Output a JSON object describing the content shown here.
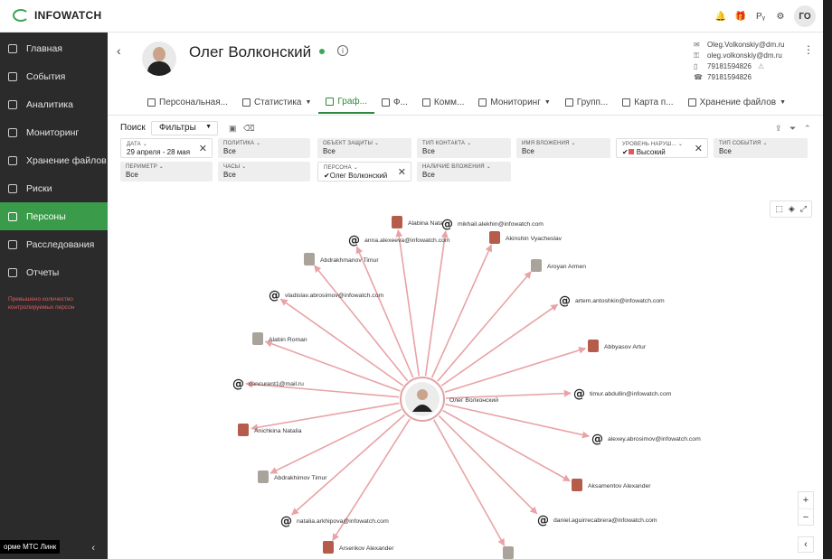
{
  "app": {
    "logo_text": "INFOWATCH",
    "user_initials": "ГО"
  },
  "top_icons": [
    "bell-icon",
    "gift-icon",
    "language-icon",
    "settings-icon"
  ],
  "top_icon_glyphs": [
    "🔔",
    "🎁",
    "Рᵧ",
    "⚙"
  ],
  "sidebar": {
    "items": [
      {
        "label": "Главная",
        "icon": "home-icon"
      },
      {
        "label": "События",
        "icon": "events-icon"
      },
      {
        "label": "Аналитика",
        "icon": "analytics-icon"
      },
      {
        "label": "Мониторинг",
        "icon": "monitoring-icon"
      },
      {
        "label": "Хранение файлов",
        "icon": "file-storage-icon"
      },
      {
        "label": "Риски",
        "icon": "risks-icon"
      },
      {
        "label": "Персоны",
        "icon": "persons-icon",
        "active": true
      },
      {
        "label": "Расследования",
        "icon": "investigations-icon"
      },
      {
        "label": "Отчеты",
        "icon": "reports-icon"
      }
    ],
    "warning": "Превышено количество контролируемых персон",
    "footer_label": "орме МТС Линк",
    "collapse_glyph": "‹"
  },
  "person": {
    "name": "Олег Волконский",
    "emails": [
      "Oleg.Volkonskiy@dm.ru",
      "oleg.volkonskiy@dm.ru"
    ],
    "phones": [
      "79181594826",
      "79181594826"
    ],
    "phone_warning": "⚠"
  },
  "tabs": [
    {
      "label": "Персональная...",
      "dropdown": false
    },
    {
      "label": "Статистика",
      "dropdown": true
    },
    {
      "label": "Граф...",
      "dropdown": false,
      "active": true
    },
    {
      "label": "Ф...",
      "dropdown": false
    },
    {
      "label": "Комм...",
      "dropdown": false
    },
    {
      "label": "Мониторинг",
      "dropdown": true
    },
    {
      "label": "Групп...",
      "dropdown": false
    },
    {
      "label": "Карта п...",
      "dropdown": false
    },
    {
      "label": "Хранение файлов",
      "dropdown": true
    }
  ],
  "filter_bar": {
    "search_label": "Поиск",
    "filters_value": "Фильтры"
  },
  "filters": [
    {
      "label": "ДАТА",
      "value": "29 апреля - 28 мая",
      "set": true
    },
    {
      "label": "ПОЛИТИКА",
      "value": "Все",
      "set": false
    },
    {
      "label": "ОБЪЕКТ ЗАЩИТЫ",
      "value": "Все",
      "set": false
    },
    {
      "label": "ТИП КОНТАКТА",
      "value": "Все",
      "set": false
    },
    {
      "label": "ИМЯ ВЛОЖЕНИЯ",
      "value": "Все",
      "set": false
    },
    {
      "label": "УРОВЕНЬ НАРУШ...",
      "value": "Высокий",
      "set": true
    },
    {
      "label": "ТИП СОБЫТИЯ",
      "value": "Все",
      "set": false
    },
    {
      "label": "ПЕРИМЕТР",
      "value": "Все",
      "set": false
    },
    {
      "label": "ЧАСЫ",
      "value": "Все",
      "set": false
    },
    {
      "label": "ПЕРСОНА",
      "value": "Олег Волконский",
      "set": true
    },
    {
      "label": "НАЛИЧИЕ ВЛОЖЕНИЯ",
      "value": "Все",
      "set": false
    }
  ],
  "graph": {
    "center_label": "Олег Волконский",
    "edge_color": "#e8a3a6",
    "nodes": [
      {
        "label": "Alabina Nata",
        "kind": "person"
      },
      {
        "label": "mikhail.alekhin@infowatch.com",
        "kind": "email"
      },
      {
        "label": "anna.alexeeva@infowatch.com",
        "kind": "email"
      },
      {
        "label": "Akinshin Vyacheslav",
        "kind": "person"
      },
      {
        "label": "Abdrakhmanov Timur",
        "kind": "person"
      },
      {
        "label": "Aroyan Armen",
        "kind": "person"
      },
      {
        "label": "vladislav.abrosimov@infowatch.com",
        "kind": "email"
      },
      {
        "label": "artem.antoshkin@infowatch.com",
        "kind": "email"
      },
      {
        "label": "Alabin Roman",
        "kind": "person"
      },
      {
        "label": "Abbyasov Artur",
        "kind": "person"
      },
      {
        "label": "concurent1@mail.ru",
        "kind": "email"
      },
      {
        "label": "timur.abdullin@infowatch.com",
        "kind": "email"
      },
      {
        "label": "Anichkina Natalia",
        "kind": "person"
      },
      {
        "label": "alexey.abrosimov@infowatch.com",
        "kind": "email"
      },
      {
        "label": "Abdrakhimov Timur",
        "kind": "person"
      },
      {
        "label": "Aksamentov Alexander",
        "kind": "person"
      },
      {
        "label": "natalia.arkhipova@infowatch.com",
        "kind": "email"
      },
      {
        "label": "daniel.aguirrecabrera@infowatch.com",
        "kind": "email"
      },
      {
        "label": "Arsenkov Alexander",
        "kind": "person"
      },
      {
        "label": "",
        "kind": "person"
      }
    ]
  }
}
